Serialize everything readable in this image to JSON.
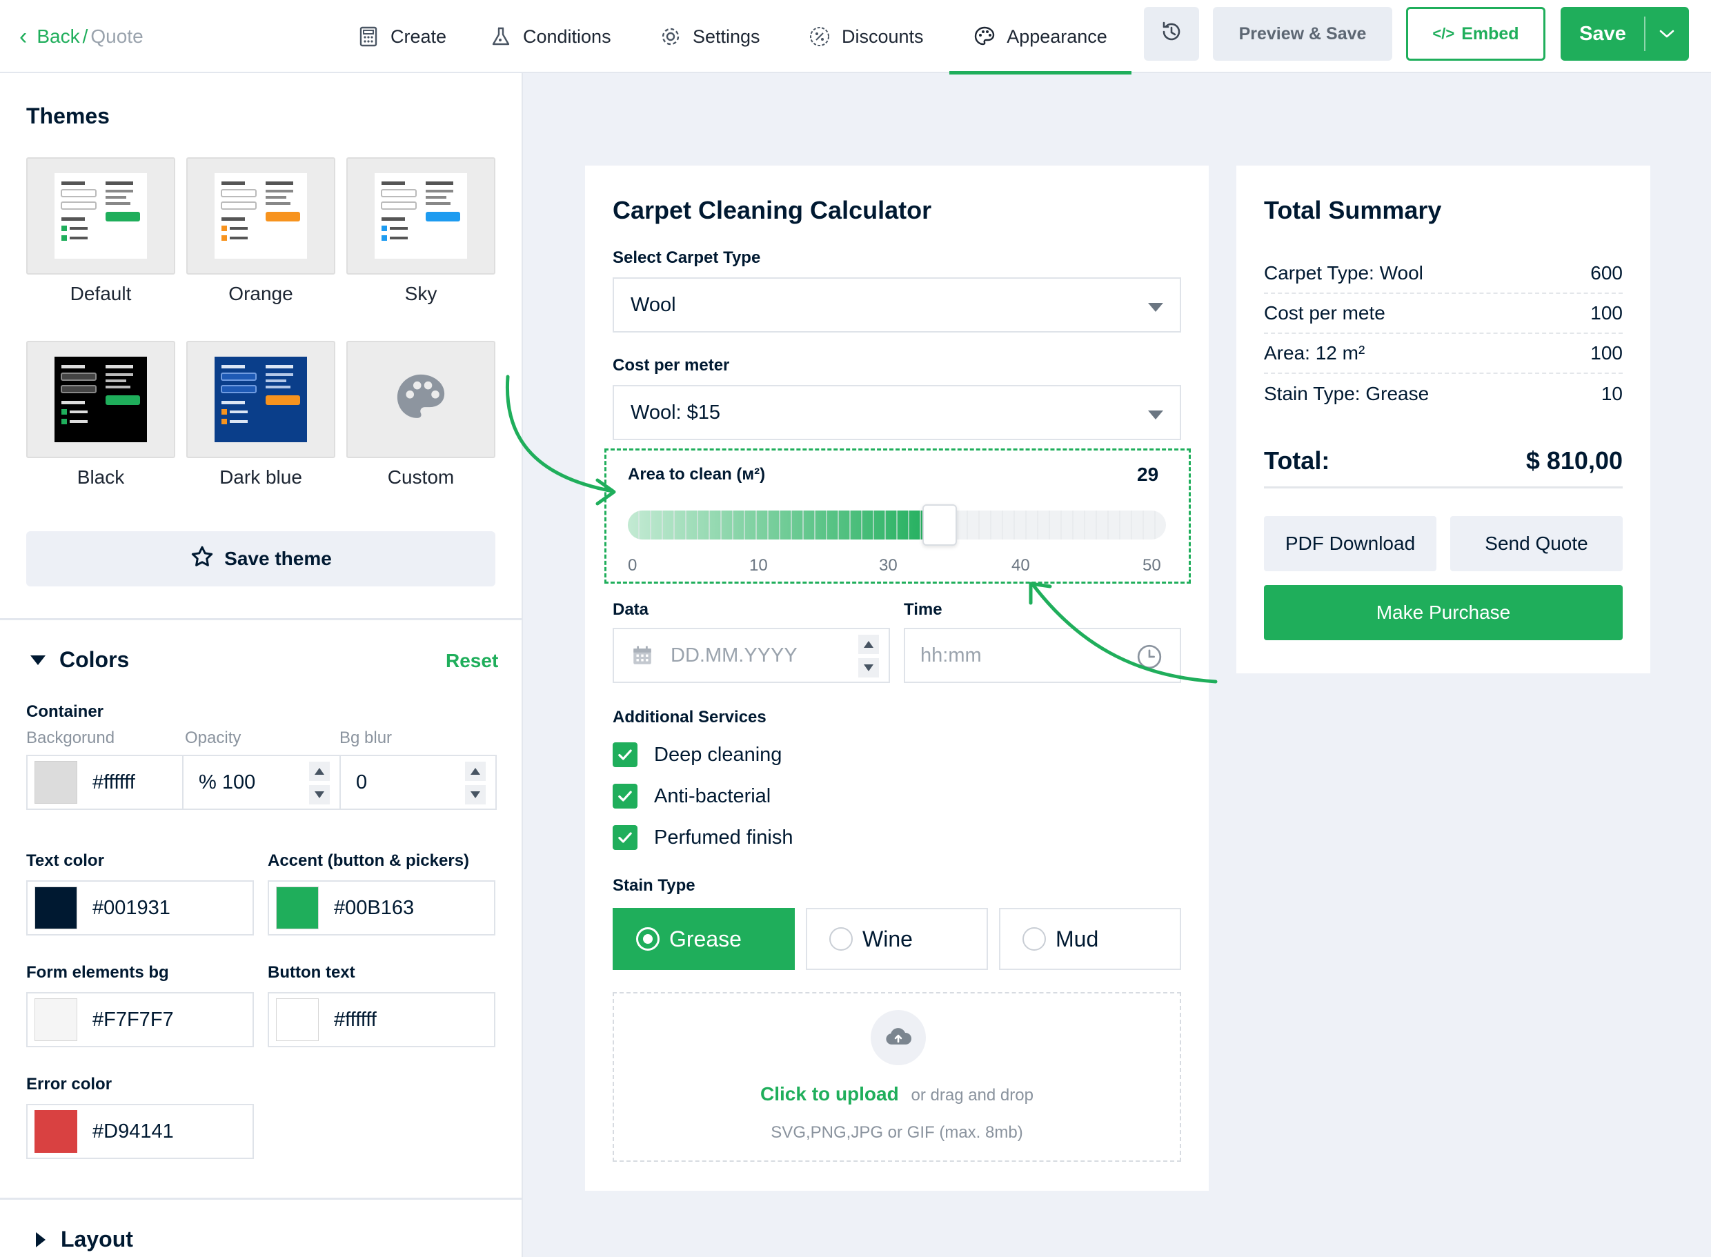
{
  "header": {
    "back_label": "Back",
    "separator": "/",
    "breadcrumb_current": "Quote",
    "nav": [
      {
        "label": "Create",
        "icon": "calculator-icon"
      },
      {
        "label": "Conditions",
        "icon": "flask-icon"
      },
      {
        "label": "Settings",
        "icon": "gear-icon"
      },
      {
        "label": "Discounts",
        "icon": "percent-icon"
      },
      {
        "label": "Appearance",
        "icon": "palette-icon",
        "active": true
      }
    ],
    "history_icon": "history-icon",
    "preview_save": "Preview & Save",
    "embed": "Embed",
    "embed_icon": "code-icon",
    "save": "Save",
    "accent_color": "#1fae5b"
  },
  "sidebar": {
    "themes_title": "Themes",
    "themes": [
      {
        "name": "Default",
        "accent": "#1fae5b"
      },
      {
        "name": "Orange",
        "accent": "#f7931e"
      },
      {
        "name": "Sky",
        "accent": "#1d9bf0"
      },
      {
        "name": "Black",
        "accent": "#1fae5b"
      },
      {
        "name": "Dark blue",
        "accent": "#f7931e"
      },
      {
        "name": "Custom",
        "icon": "palette-icon"
      }
    ],
    "save_theme": "Save theme",
    "colors": {
      "title": "Colors",
      "reset": "Reset",
      "container_label": "Container",
      "background_label": "Backgorund",
      "opacity_label": "Opacity",
      "blur_label": "Bg blur",
      "background_value": "#ffffff",
      "opacity_value": "% 100",
      "blur_value": "0",
      "text_color_label": "Text color",
      "text_color_value": "#001931",
      "accent_label": "Accent (button & pickers)",
      "accent_value": "#00B163",
      "form_bg_label": "Form elements bg",
      "form_bg_value": "#F7F7F7",
      "button_text_label": "Button text",
      "button_text_value": "#ffffff",
      "error_label": "Error color",
      "error_value": "#D94141",
      "swatches": {
        "background": "#dcdcdc",
        "text": "#001931",
        "accent": "#1fae5b",
        "form_bg": "#f5f5f5",
        "button_text": "#ffffff",
        "error": "#d94141"
      }
    },
    "layout_title": "Layout"
  },
  "calculator": {
    "title": "Carpet Cleaning Calculator",
    "carpet_type_label": "Select Carpet Type",
    "carpet_type_value": "Wool",
    "cost_label": "Cost per meter",
    "cost_value": "Wool: $15",
    "area_label": "Area to clean (м²)",
    "area_value": "29",
    "slider": {
      "min": 0,
      "max": 50,
      "value": 29,
      "scale": [
        "0",
        "10",
        "30",
        "40",
        "50"
      ]
    },
    "date_label": "Data",
    "date_placeholder": "DD.MM.YYYY",
    "time_label": "Time",
    "time_placeholder": "hh:mm",
    "services_label": "Additional Services",
    "services": [
      {
        "label": "Deep cleaning",
        "checked": true
      },
      {
        "label": "Anti-bacterial",
        "checked": true
      },
      {
        "label": "Perfumed finish",
        "checked": true
      }
    ],
    "stain_label": "Stain Type",
    "stains": [
      {
        "label": "Grease",
        "selected": true
      },
      {
        "label": "Wine",
        "selected": false
      },
      {
        "label": "Mud",
        "selected": false
      }
    ],
    "upload": {
      "link": "Click to upload",
      "text": "or drag and drop",
      "hint": "SVG,PNG,JPG or GIF (max. 8mb)"
    }
  },
  "summary": {
    "title": "Total Summary",
    "rows": [
      {
        "label": "Carpet Type: Wool",
        "value": "600"
      },
      {
        "label": "Cost per mete",
        "value": "100"
      },
      {
        "label": "Area: 12 m²",
        "value": "100"
      },
      {
        "label": "Stain Type: Grease",
        "value": "10"
      }
    ],
    "total_label": "Total:",
    "total_value": "$ 810,00",
    "pdf": "PDF Download",
    "send": "Send Quote",
    "purchase": "Make Purchase"
  }
}
